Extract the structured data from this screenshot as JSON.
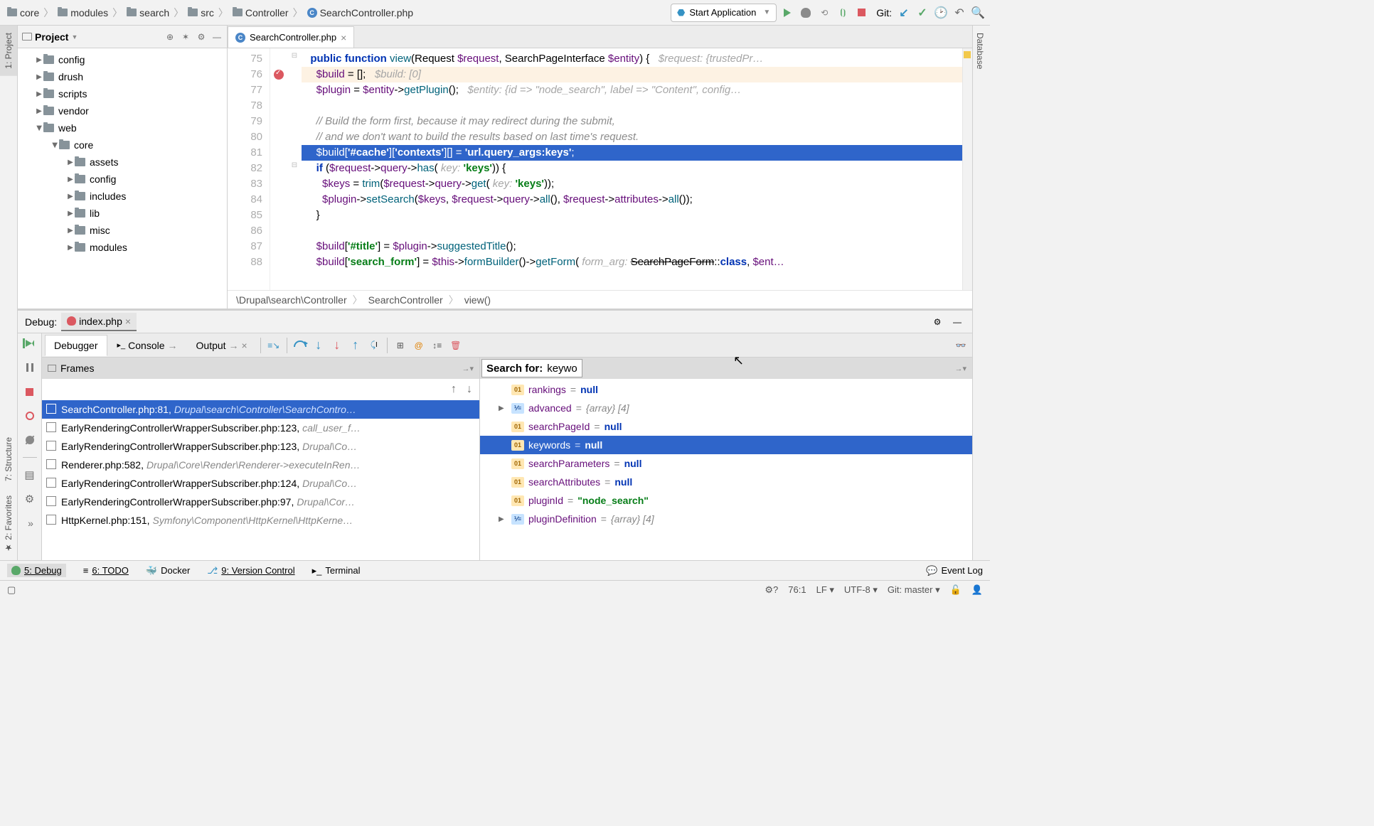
{
  "breadcrumb": [
    "core",
    "modules",
    "search",
    "src",
    "Controller",
    "SearchController.php"
  ],
  "runConfig": "Start Application",
  "gitLabel": "Git:",
  "leftRail": {
    "project": "1: Project",
    "structure": "7: Structure",
    "favorites": "2: Favorites"
  },
  "rightRail": {
    "database": "Database"
  },
  "projectPanel": {
    "title": "Project",
    "tree": [
      {
        "name": "config",
        "depth": 0,
        "open": false
      },
      {
        "name": "drush",
        "depth": 0,
        "open": false
      },
      {
        "name": "scripts",
        "depth": 0,
        "open": false
      },
      {
        "name": "vendor",
        "depth": 0,
        "open": false
      },
      {
        "name": "web",
        "depth": 0,
        "open": true
      },
      {
        "name": "core",
        "depth": 1,
        "open": true
      },
      {
        "name": "assets",
        "depth": 2,
        "open": false
      },
      {
        "name": "config",
        "depth": 2,
        "open": false
      },
      {
        "name": "includes",
        "depth": 2,
        "open": false
      },
      {
        "name": "lib",
        "depth": 2,
        "open": false
      },
      {
        "name": "misc",
        "depth": 2,
        "open": false
      },
      {
        "name": "modules",
        "depth": 2,
        "open": false
      }
    ]
  },
  "editorTab": {
    "name": "SearchController.php"
  },
  "code": {
    "start": 75,
    "lines": [
      {
        "n": 75,
        "html": "  <span class='kw'>public</span> <span class='kw'>function</span> <span class='fn'>view</span>(Request <span class='var'>$request</span>, SearchPageInterface <span class='var'>$entity</span>) {   <span class='hint'>$request: {trustedPr…</span>"
      },
      {
        "n": 76,
        "cls": "hl-band",
        "bp": true,
        "html": "    <span class='var'>$build</span> = [];   <span class='hint'>$build: [0]</span>"
      },
      {
        "n": 77,
        "html": "    <span class='var'>$plugin</span> = <span class='var'>$entity</span>-><span class='fn'>getPlugin</span>();   <span class='hint'>$entity: {id =&gt; \"node_search\", label =&gt; \"Content\", config…</span>"
      },
      {
        "n": 78,
        "html": ""
      },
      {
        "n": 79,
        "html": "    <span class='cmt'>// Build the form first, because it may redirect during the submit,</span>"
      },
      {
        "n": 80,
        "html": "    <span class='cmt'>// and we don't want to build the results based on last time's request.</span>"
      },
      {
        "n": 81,
        "cls": "hl-line",
        "html": "    <span class='var'>$build</span>[<span class='str'>'#cache'</span>][<span class='str'>'contexts'</span>][] = <span class='str'>'url.query_args:keys'</span>;"
      },
      {
        "n": 82,
        "html": "    <span class='kw'>if</span> (<span class='var'>$request</span>-><span class='var'>query</span>-><span class='fn'>has</span>( <span class='hint'>key:</span> <span class='str'>'keys'</span>)) {"
      },
      {
        "n": 83,
        "html": "      <span class='var'>$keys</span> = <span class='fn'>trim</span>(<span class='var'>$request</span>-><span class='var'>query</span>-><span class='fn'>get</span>( <span class='hint'>key:</span> <span class='str'>'keys'</span>));"
      },
      {
        "n": 84,
        "html": "      <span class='var'>$plugin</span>-><span class='fn'>setSearch</span>(<span class='var'>$keys</span>, <span class='var'>$request</span>-><span class='var'>query</span>-><span class='fn'>all</span>(), <span class='var'>$request</span>-><span class='var'>attributes</span>-><span class='fn'>all</span>());"
      },
      {
        "n": 85,
        "html": "    }"
      },
      {
        "n": 86,
        "html": ""
      },
      {
        "n": 87,
        "html": "    <span class='var'>$build</span>[<span class='str'>'#title'</span>] = <span class='var'>$plugin</span>-><span class='fn'>suggestedTitle</span>();"
      },
      {
        "n": 88,
        "html": "    <span class='var'>$build</span>[<span class='str'>'search_form'</span>] = <span class='var'>$this</span>-><span class='fn'>formBuilder</span>()-><span class='fn'>getForm</span>( <span class='hint'>form_arg:</span> <span class='strike'>SearchPageForm</span>::<span class='kw'>class</span>, <span class='var'>$ent…</span>"
      }
    ]
  },
  "navCrumb": [
    "\\Drupal\\search\\Controller",
    "SearchController",
    "view()"
  ],
  "debug": {
    "label": "Debug:",
    "config": "index.php",
    "tabs": {
      "debugger": "Debugger",
      "console": "Console",
      "output": "Output"
    },
    "framesLabel": "Frames",
    "frames": [
      {
        "file": "SearchController.php:81,",
        "ctx": "Drupal\\search\\Controller\\SearchContro…",
        "sel": true
      },
      {
        "file": "EarlyRenderingControllerWrapperSubscriber.php:123,",
        "ctx": "call_user_f…"
      },
      {
        "file": "EarlyRenderingControllerWrapperSubscriber.php:123,",
        "ctx": "Drupal\\Co…"
      },
      {
        "file": "Renderer.php:582,",
        "ctx": "Drupal\\Core\\Render\\Renderer->executeInRen…"
      },
      {
        "file": "EarlyRenderingControllerWrapperSubscriber.php:124,",
        "ctx": "Drupal\\Co…"
      },
      {
        "file": "EarlyRenderingControllerWrapperSubscriber.php:97,",
        "ctx": "Drupal\\Cor…"
      },
      {
        "file": "HttpKernel.php:151,",
        "ctx": "Symfony\\Component\\HttpKernel\\HttpKerne…"
      }
    ],
    "search": {
      "label": "Search for:",
      "value": "keywo"
    },
    "vars": [
      {
        "name": "rankings",
        "op": "=",
        "val": "null",
        "type": "null",
        "badge": "prim",
        "indent": 1
      },
      {
        "name": "advanced",
        "op": "=",
        "val": "{array} [4]",
        "type": "arr",
        "badge": "arr",
        "indent": 1,
        "exp": true
      },
      {
        "name": "searchPageId",
        "op": "=",
        "val": "null",
        "type": "null",
        "badge": "prim",
        "indent": 1
      },
      {
        "name": "keywords",
        "op": "=",
        "val": "null",
        "type": "null",
        "badge": "prim",
        "indent": 1,
        "sel": true
      },
      {
        "name": "searchParameters",
        "op": "=",
        "val": "null",
        "type": "null",
        "badge": "prim",
        "indent": 1
      },
      {
        "name": "searchAttributes",
        "op": "=",
        "val": "null",
        "type": "null",
        "badge": "prim",
        "indent": 1
      },
      {
        "name": "pluginId",
        "op": "=",
        "val": "\"node_search\"",
        "type": "str",
        "badge": "prim",
        "indent": 1
      },
      {
        "name": "pluginDefinition",
        "op": "=",
        "val": "{array} [4]",
        "type": "arr",
        "badge": "arr",
        "indent": 1,
        "exp": true
      }
    ]
  },
  "toolStrip": {
    "debug": "5: Debug",
    "todo": "6: TODO",
    "docker": "Docker",
    "vcs": "9: Version Control",
    "terminal": "Terminal",
    "eventLog": "Event Log"
  },
  "status": {
    "pos": "76:1",
    "lf": "LF",
    "enc": "UTF-8",
    "branch": "Git: master"
  }
}
